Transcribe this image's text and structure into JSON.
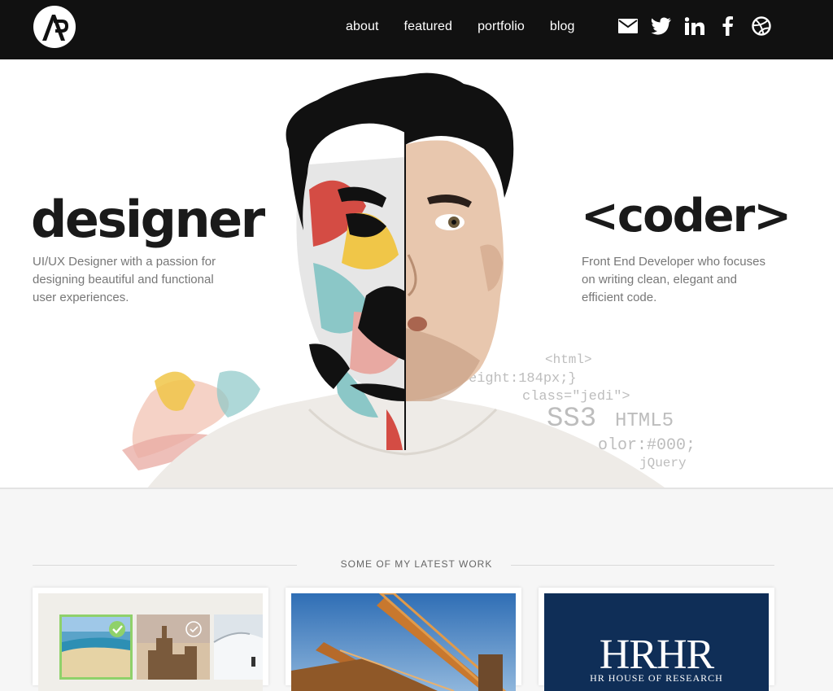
{
  "header": {
    "logo_alt": "AP",
    "nav": [
      {
        "label": "about"
      },
      {
        "label": "featured"
      },
      {
        "label": "portfolio"
      },
      {
        "label": "blog"
      }
    ],
    "social": [
      "mail-icon",
      "twitter-icon",
      "linkedin-icon",
      "facebook-icon",
      "dribbble-icon"
    ]
  },
  "hero": {
    "left_title": "designer",
    "left_desc": "UI/UX Designer with a passion for designing beautiful and functional user experiences.",
    "right_title": "<coder>",
    "right_desc": "Front End Developer who focuses on writing clean, elegant and efficient code.",
    "code_snippets": [
      "<html>",
      "eight:184px;}",
      "class=\"jedi\">",
      "SS3",
      "HTML5",
      "olor:#000;",
      "jQuery"
    ]
  },
  "work": {
    "section_title": "SOME OF MY LATEST WORK",
    "card3_logo": "HRHR",
    "card3_sub": "HR HOUSE OF RESEARCH"
  },
  "colors": {
    "header_bg": "#111111",
    "hero_bg": "#ffffff",
    "page_bg": "#f6f6f6",
    "hrhr_bg": "#0f2e57",
    "check_green": "#8fd16a"
  }
}
